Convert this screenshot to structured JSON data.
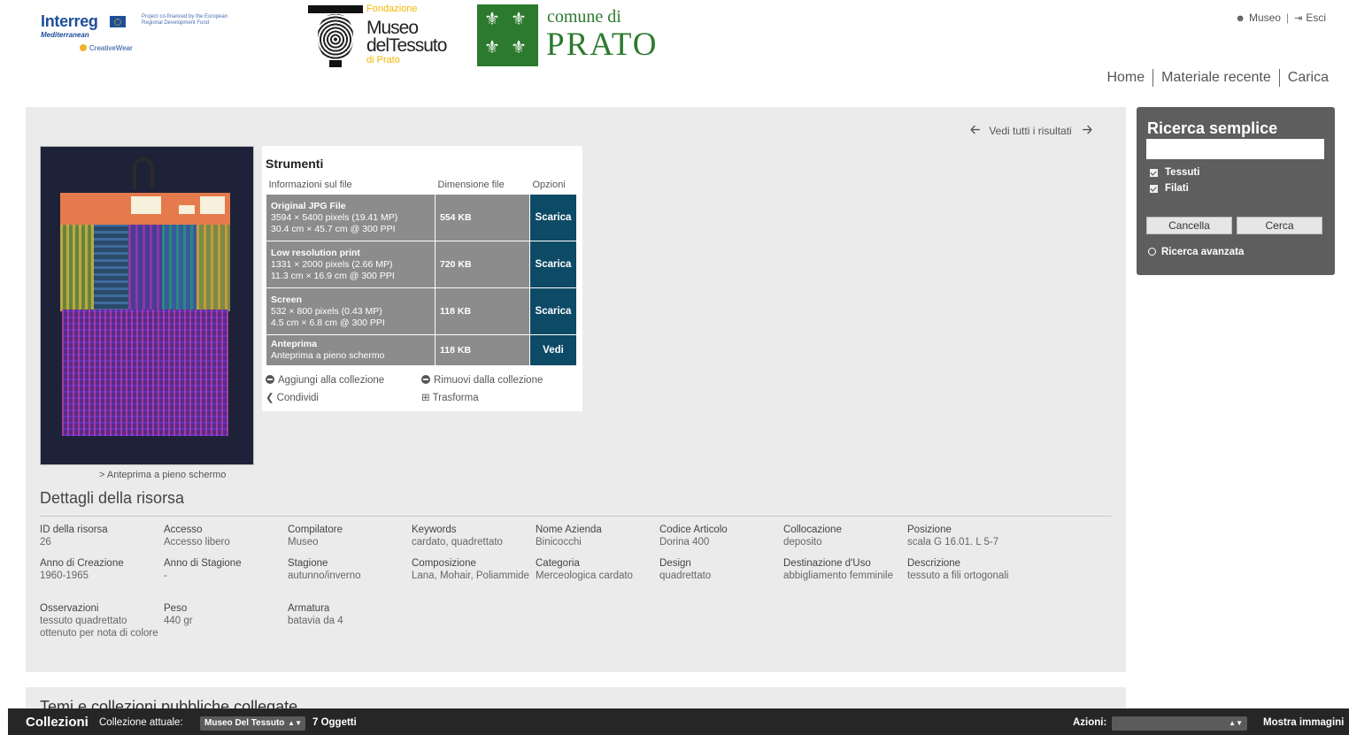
{
  "header": {
    "interreg": {
      "name": "Interreg",
      "funding": "Project co-financed by the European Regional Development Fund",
      "program": "Mediterranean",
      "project": "CreativeWear"
    },
    "museo": {
      "fondazione": "Fondazione",
      "line1": "Museo",
      "line2": "delTessuto",
      "di": "di Prato"
    },
    "prato": {
      "small": "comune di",
      "big": "PRATO"
    },
    "user": {
      "name": "Museo",
      "logout": "Esci"
    },
    "nav": [
      "Home",
      "Materiale recente",
      "Carica"
    ]
  },
  "result_nav": {
    "label": "Vedi tutti i risultati",
    "prev_icon": "arrow-left-icon",
    "next_icon": "arrow-right-icon"
  },
  "preview": {
    "link": "> Anteprima a pieno schermo"
  },
  "tools": {
    "title": "Strumenti",
    "columns": [
      "Informazioni sul file",
      "Dimensione file",
      "Opzioni"
    ],
    "rows": [
      {
        "name": "Original JPG File",
        "line1": "3594 × 5400 pixels (19.41 MP)",
        "line2": "30.4 cm × 45.7 cm @ 300 PPI",
        "size": "554 KB",
        "action": "Scarica"
      },
      {
        "name": "Low resolution print",
        "line1": "1331 × 2000 pixels (2.66 MP)",
        "line2": "11.3 cm × 16.9 cm @ 300 PPI",
        "size": "720 KB",
        "action": "Scarica"
      },
      {
        "name": "Screen",
        "line1": "532 × 800 pixels (0.43 MP)",
        "line2": "4.5 cm × 6.8 cm @ 300 PPI",
        "size": "118 KB",
        "action": "Scarica"
      },
      {
        "name": "Anteprima",
        "line1": "Anteprima a pieno schermo",
        "line2": "",
        "size": "118 KB",
        "action": "Vedi"
      }
    ],
    "actions": {
      "add": "Aggiungi alla collezione",
      "remove": "Rimuovi dalla collezione",
      "share": "Condividi",
      "transform": "Trasforma"
    }
  },
  "details": {
    "title": "Dettagli della risorsa",
    "fields": [
      {
        "key": "ID della risorsa",
        "value": "26"
      },
      {
        "key": "Accesso",
        "value": "Accesso libero"
      },
      {
        "key": "Compilatore",
        "value": "Museo"
      },
      {
        "key": "Keywords",
        "value": "cardato, quadrettato"
      },
      {
        "key": "Nome Azienda",
        "value": "Binicocchi"
      },
      {
        "key": "Codice Articolo",
        "value": "Dorina 400"
      },
      {
        "key": "Collocazione",
        "value": "deposito"
      },
      {
        "key": "Posizione",
        "value": "scala G 16.01. L 5-7"
      },
      {
        "key": "Anno di Creazione",
        "value": "1960-1965"
      },
      {
        "key": "Anno di Stagione",
        "value": "-"
      },
      {
        "key": "Stagione",
        "value": "autunno/inverno"
      },
      {
        "key": "Composizione",
        "value": "Lana, Mohair, Poliammide"
      },
      {
        "key": "Categoria",
        "value": "Merceologica cardato"
      },
      {
        "key": "Design",
        "value": "quadrettato"
      },
      {
        "key": "Destinazione d'Uso",
        "value": "abbigliamento femminile"
      },
      {
        "key": "Descrizione",
        "value": "tessuto a fili ortogonali"
      },
      {
        "key": "Osservazioni",
        "value": "tessuto quadrettato ottenuto per nota di colore"
      },
      {
        "key": "Peso",
        "value": "440 gr"
      },
      {
        "key": "Armatura",
        "value": "batavia da 4"
      }
    ]
  },
  "related": {
    "title": "Temi e collezioni pubbliche collegate"
  },
  "search": {
    "title": "Ricerca semplice",
    "value": "",
    "options": [
      {
        "label": "Tessuti",
        "checked": true
      },
      {
        "label": "Filati",
        "checked": true
      }
    ],
    "clear": "Cancella",
    "submit": "Cerca",
    "advanced": "Ricerca avanzata"
  },
  "bottom_bar": {
    "title": "Collezioni",
    "current_label": "Collezione attuale:",
    "current_value": "Museo Del Tessuto",
    "count": "7 Oggetti",
    "actions_label": "Azioni:",
    "actions_value": "",
    "show_images": "Mostra immagini"
  },
  "colors": {
    "download_button": "#0d4a66",
    "table_cell": "#8c8c8c",
    "panel_bg": "#ebebeb",
    "sidebar_bg": "#5e5e5e",
    "bottom_bar_bg": "#262626",
    "prato_green": "#2c7a2e",
    "interreg_blue": "#1f4e9b"
  }
}
